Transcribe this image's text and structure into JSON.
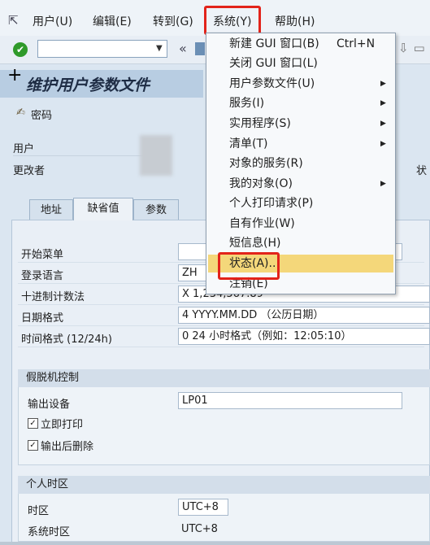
{
  "menubar": {
    "items": [
      {
        "label": "用户(U)"
      },
      {
        "label": "编辑(E)"
      },
      {
        "label": "转到(G)"
      },
      {
        "label": "系统(Y)"
      },
      {
        "label": "帮助(H)"
      }
    ]
  },
  "toolbar": {
    "command_value": "",
    "back_glyph": "«"
  },
  "page": {
    "title": "维护用户参数文件",
    "password_button": "密码",
    "user_label": "用户",
    "changed_by_label": "更改者",
    "right_cut_label": "状"
  },
  "tabs": [
    {
      "label": "地址",
      "active": false
    },
    {
      "label": "缺省值",
      "active": true
    },
    {
      "label": "参数",
      "active": false
    }
  ],
  "defaults": {
    "start_menu_label": "开始菜单",
    "start_menu_value": "",
    "logon_lang_label": "登录语言",
    "logon_lang_value": "ZH",
    "decimal_label": "十进制计数法",
    "decimal_value": "X 1,234,567.89",
    "date_label": "日期格式",
    "date_value": "4 YYYY.MM.DD （公历日期）",
    "time_label": "时间格式 (12/24h)",
    "time_value": "0 24 小时格式（例如：12:05:10）"
  },
  "spool": {
    "header": "假脱机控制",
    "output_device_label": "输出设备",
    "output_device_value": "LP01",
    "print_immediately": "立即打印",
    "delete_after_output": "输出后删除"
  },
  "timezone": {
    "header": "个人时区",
    "tz_label": "时区",
    "tz_value": "UTC+8",
    "sys_tz_label": "系统时区",
    "sys_tz_value": "UTC+8"
  },
  "system_menu": {
    "items": [
      {
        "label": "新建 GUI 窗口(B)",
        "shortcut": "Ctrl+N",
        "submenu": false
      },
      {
        "label": "关闭 GUI 窗口(L)",
        "shortcut": "",
        "submenu": false
      },
      {
        "label": "用户参数文件(U)",
        "shortcut": "",
        "submenu": true
      },
      {
        "label": "服务(I)",
        "shortcut": "",
        "submenu": true
      },
      {
        "label": "实用程序(S)",
        "shortcut": "",
        "submenu": true
      },
      {
        "label": "清单(T)",
        "shortcut": "",
        "submenu": true
      },
      {
        "label": "对象的服务(R)",
        "shortcut": "",
        "submenu": false
      },
      {
        "label": "我的对象(O)",
        "shortcut": "",
        "submenu": true
      },
      {
        "label": "个人打印请求(P)",
        "shortcut": "",
        "submenu": false
      },
      {
        "label": "自有作业(W)",
        "shortcut": "",
        "submenu": false
      },
      {
        "label": "短信息(H)",
        "shortcut": "",
        "submenu": false
      },
      {
        "label": "状态(A)..",
        "shortcut": "",
        "submenu": false
      },
      {
        "label": "注销(E)",
        "shortcut": "",
        "submenu": false
      }
    ],
    "highlight_color": "#f4d77a",
    "annotation_color": "#e2231a"
  }
}
